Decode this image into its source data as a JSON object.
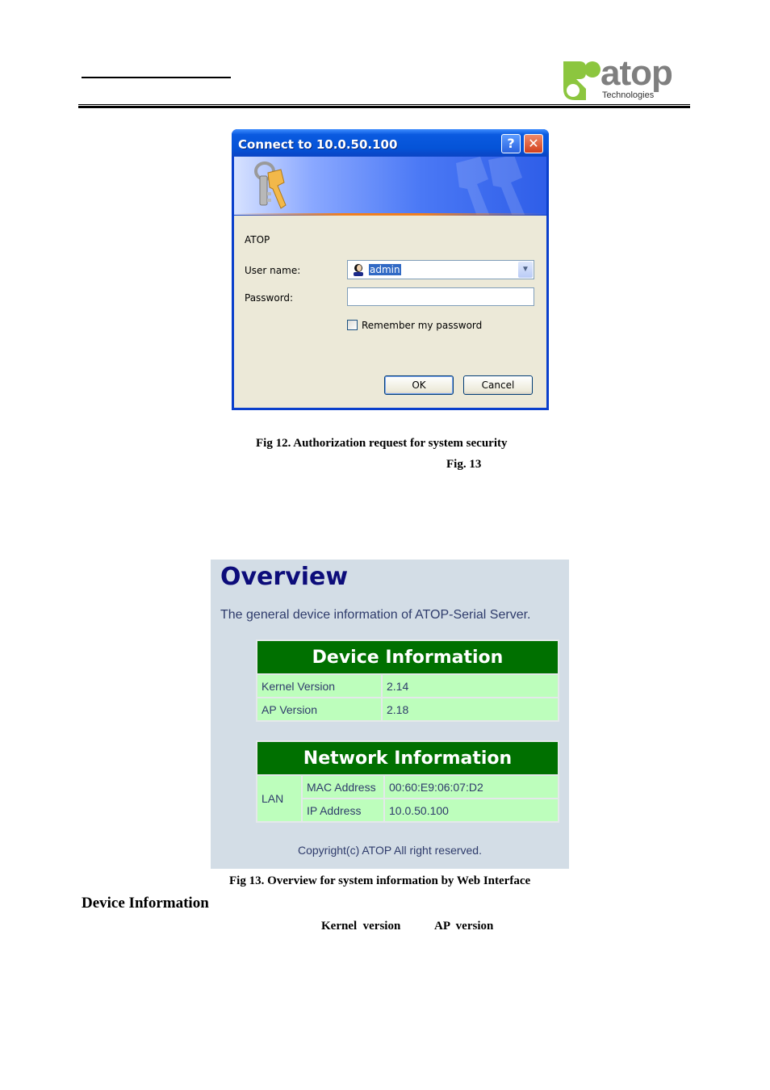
{
  "header": {
    "logo": {
      "word": "atop",
      "sub": "Technologies",
      "brand_green": "#8cc63f",
      "brand_gray": "#7f7f7f"
    }
  },
  "login_dialog": {
    "title": "Connect to 10.0.50.100",
    "help_glyph": "?",
    "close_glyph": "✕",
    "realm": "ATOP",
    "username_label": "User name:",
    "username_value": "admin",
    "password_label": "Password:",
    "password_value": "",
    "remember_label": "Remember my password",
    "remember_checked": false,
    "ok_label": "OK",
    "cancel_label": "Cancel",
    "combo_arrow": "▼"
  },
  "captions": {
    "fig12": "Fig 12. Authorization request for system security",
    "fig13_ref": "Fig. 13",
    "fig13": "Fig 13. Overview for system information by Web Interface"
  },
  "overview": {
    "title": "Overview",
    "description": "The general device information of ATOP-Serial Server.",
    "device_info": {
      "header": "Device Information",
      "rows": [
        {
          "label": "Kernel Version",
          "value": "2.14"
        },
        {
          "label": "AP Version",
          "value": "2.18"
        }
      ]
    },
    "network_info": {
      "header": "Network Information",
      "group": "LAN",
      "rows": [
        {
          "label": "MAC Address",
          "value": "00:60:E9:06:07:D2"
        },
        {
          "label": "IP Address",
          "value": "10.0.50.100"
        }
      ]
    },
    "copyright": "Copyright(c) ATOP All right reserved."
  },
  "body_text": {
    "section_heading": "Device Information",
    "kernel_ref": "Kernel  version",
    "ap_ref": "AP  version"
  }
}
